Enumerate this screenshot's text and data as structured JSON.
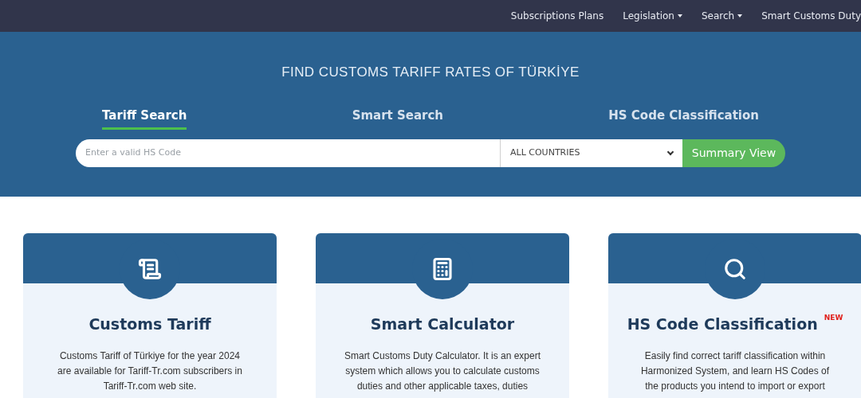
{
  "nav": [
    {
      "label": "Subscriptions Plans",
      "dropdown": false
    },
    {
      "label": "Legislation",
      "dropdown": true
    },
    {
      "label": "Search",
      "dropdown": true
    },
    {
      "label": "Smart Customs Duty",
      "dropdown": false
    }
  ],
  "hero": {
    "title": "FIND CUSTOMS TARIFF RATES OF TÜRKİYE",
    "tabs": [
      {
        "label": "Tariff Search",
        "selected": true
      },
      {
        "label": "Smart Search",
        "selected": false
      },
      {
        "label": "HS Code Classification",
        "selected": false
      }
    ],
    "search": {
      "placeholder": "Enter a valid HS Code",
      "country": "ALL COUNTRIES",
      "button": "Summary View"
    }
  },
  "cards": [
    {
      "kind": "scroll",
      "title": "Customs Tariff",
      "lines": [
        "Customs Tariff of Türkiye for the year 2024",
        "are available for Tariff-Tr.com subscribers in",
        "Tariff-Tr.com web site."
      ]
    },
    {
      "kind": "calculator",
      "title": "Smart Calculator",
      "lines": [
        "Smart Customs Duty Calculator. It is an expert",
        "system which allows you to calculate customs",
        "duties and other applicable taxes, duties"
      ]
    },
    {
      "kind": "search",
      "title": "HS Code Classification",
      "badge": "NEW",
      "lines": [
        "Easily find correct tariff classification within",
        "Harmonized System, and learn HS Codes of",
        "the products you intend to import or export"
      ]
    }
  ]
}
